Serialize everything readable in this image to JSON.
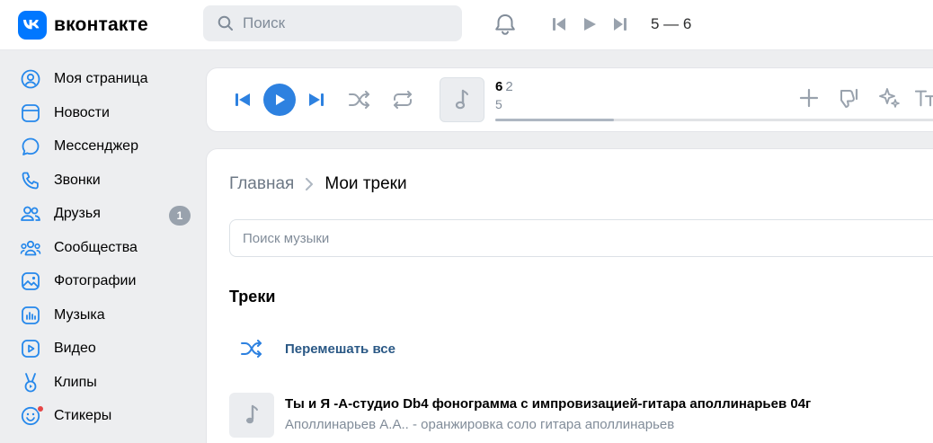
{
  "app": {
    "brand": "вконтакте"
  },
  "header": {
    "search_placeholder": "Поиск",
    "mini_player_title": "5 — 6"
  },
  "sidebar": {
    "items": [
      {
        "label": "Моя страница",
        "icon": "user-circle-icon"
      },
      {
        "label": "Новости",
        "icon": "newsfeed-icon"
      },
      {
        "label": "Мессенджер",
        "icon": "message-icon"
      },
      {
        "label": "Звонки",
        "icon": "phone-icon"
      },
      {
        "label": "Друзья",
        "icon": "users-icon",
        "badge": "1"
      },
      {
        "label": "Сообщества",
        "icon": "communities-icon"
      },
      {
        "label": "Фотографии",
        "icon": "photo-icon"
      },
      {
        "label": "Музыка",
        "icon": "music-icon"
      },
      {
        "label": "Видео",
        "icon": "video-icon"
      },
      {
        "label": "Клипы",
        "icon": "clips-icon"
      },
      {
        "label": "Стикеры",
        "icon": "sticker-icon",
        "has_dot": true
      }
    ]
  },
  "player": {
    "track_number": "6",
    "track_subtitle": "2",
    "artist": "5",
    "progress": 0.27
  },
  "content": {
    "breadcrumb_home": "Главная",
    "breadcrumb_current": "Мои треки",
    "search_placeholder": "Поиск музыки",
    "section_title": "Треки",
    "shuffle_label": "Перемешать все",
    "tracks": [
      {
        "title": "Ты и Я -А-студио Db4 фонограмма с импровизацией-гитара аполлинарьев 04г",
        "artist": "Аполлинарьев А.А.. - оранжировка соло гитара аполлинарьев"
      }
    ]
  },
  "colors": {
    "brand": "#0077ff",
    "accent": "#2d81e0",
    "link": "#2a5885"
  }
}
